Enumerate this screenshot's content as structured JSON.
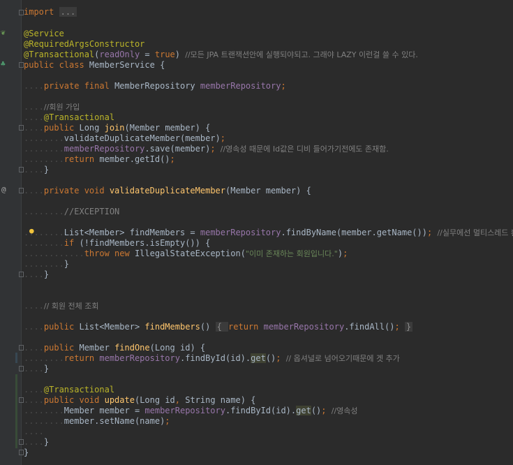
{
  "editor": {
    "lines": {
      "l1": {
        "kw": "import",
        "fold": "..."
      },
      "l2": {
        "a1": "@Service"
      },
      "l3": {
        "a1": "@RequiredArgsConstructor"
      },
      "l4": {
        "a1": "@Transactional",
        "p1": "(",
        "fld": "readOnly",
        "p2": " = ",
        "kw": "true",
        "p3": ") ",
        "cm": "//모든 JPA 트랜잭션안에 실행되야되고. 그래야 LAZY 이런걸 쓸 수 있다."
      },
      "l5": {
        "kw": "public class ",
        "name": "MemberService {"
      },
      "l6": {
        "kw": "private final ",
        "t": "MemberRepository ",
        "fld": "memberRepository",
        "semi": ";"
      },
      "l7": {
        "cm": "//회원 가입"
      },
      "l8": {
        "a1": "@Transactional"
      },
      "l9": {
        "kw": "public ",
        "t": "Long ",
        "fn": "join",
        "rest": "(Member member) {"
      },
      "l10": {
        "t": "validateDuplicateMember(member)",
        "semi": ";"
      },
      "l11": {
        "fld": "memberRepository",
        "t": ".save(member)",
        "semi": "; ",
        "cm": "//영속성 때문에 Id값은 디비 들어가기전에도 존재함."
      },
      "l12": {
        "kw": "return ",
        "t": "member.getId()",
        "semi": ";"
      },
      "l13": {
        "t": "}"
      },
      "l14": {
        "kw": "private void ",
        "fn": "validateDuplicateMember",
        "rest": "(Member member) {"
      },
      "l15": {
        "cm": "//EXCEPTION"
      },
      "l16": {
        "t1": "List<Member> findMembers = ",
        "fld": "memberRepository",
        "t2": ".findByName(member.getName())",
        "semi": "; ",
        "cm": "//실무에선 멀티스레드 환"
      },
      "l17": {
        "kw": "if ",
        "t": "(!findMembers.isEmpty()) {"
      },
      "l18": {
        "kw": "throw new ",
        "t": "IllegalStateException(",
        "str": "\"이미 존재하는 회원입니다.\"",
        "end": ")",
        "semi": ";"
      },
      "l19": {
        "t": "}"
      },
      "l20": {
        "t": "}"
      },
      "l21": {
        "cm": "// 회원 전체 조회"
      },
      "l22": {
        "kw1": "public ",
        "t1": "List<Member> ",
        "fn": "findMembers",
        "t2": "() ",
        "b1": "{ ",
        "kw2": "return ",
        "fld": "memberRepository",
        "t3": ".findAll()",
        "semi": "; ",
        "b2": "}"
      },
      "l23": {
        "kw": "public ",
        "t": "Member ",
        "fn": "findOne",
        "rest": "(Long id) {"
      },
      "l24": {
        "kw": "return ",
        "fld": "memberRepository",
        "t1": ".findById(id).",
        "get": "get",
        "t2": "()",
        "semi": "; ",
        "cm": "// 옵셔널로 넘어오기때문에 겟 추가"
      },
      "l25": {
        "t": "}"
      },
      "l26": {
        "a1": "@Transactional"
      },
      "l27": {
        "kw1": "public void ",
        "fn": "update",
        "t1": "(Long id",
        "c1": ", ",
        "t2": "String name) {"
      },
      "l28": {
        "t1": "Member member = ",
        "fld": "memberRepository",
        "t2": ".findById(id).",
        "get": "get",
        "t3": "()",
        "semi": "; ",
        "cm": "//영속성"
      },
      "l29": {
        "t": "member.setName(name)",
        "semi": ";"
      },
      "l30": {
        "t": "}"
      },
      "l31": {
        "t": "}"
      }
    },
    "gutter_icons": [
      "spring-bean-icon",
      "override-icon",
      "spring-class-icon",
      "lightbulb-icon"
    ],
    "colors": {
      "keyword": "#cc7832",
      "annotation": "#bbb529",
      "function": "#ffc66d",
      "field": "#9876aa",
      "string": "#6a8759",
      "comment": "#808080",
      "text": "#a9b7c6",
      "background": "#2b2b2b"
    }
  }
}
